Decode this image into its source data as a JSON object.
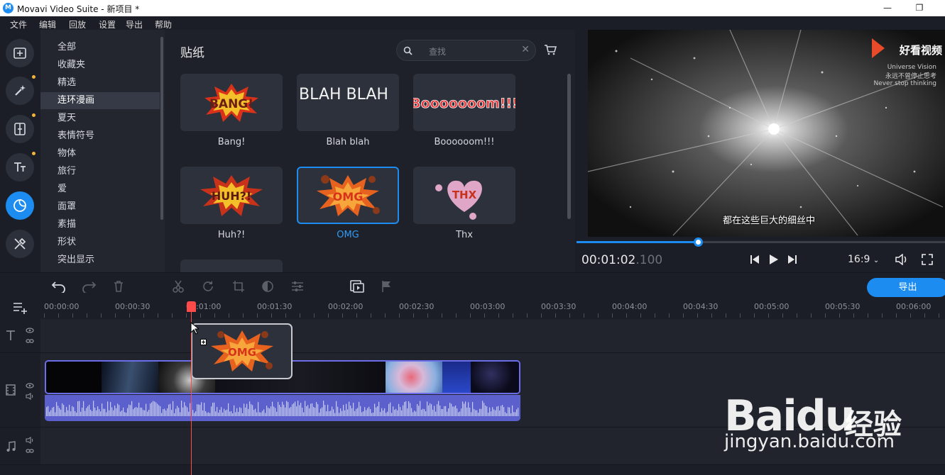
{
  "window": {
    "title": "Movavi Video Suite - 新项目 *",
    "minimize": "—",
    "restore": "❐"
  },
  "menu": [
    "文件",
    "编辑",
    "回放",
    "设置",
    "导出",
    "帮助"
  ],
  "categories": {
    "items": [
      "全部",
      "收藏夹",
      "精选",
      "连环漫画",
      "夏天",
      "表情符号",
      "物体",
      "旅行",
      "爱",
      "面罩",
      "素描",
      "形状",
      "突出显示"
    ],
    "selected": "连环漫画"
  },
  "stickers": {
    "title": "贴纸",
    "search_placeholder": "查找",
    "items": [
      {
        "label": "Bang!",
        "art": "BANG!"
      },
      {
        "label": "Blah blah",
        "art": "BLAH BLAH"
      },
      {
        "label": "Boooooom!!!",
        "art": "Booooooom!!!"
      },
      {
        "label": "Huh?!",
        "art": "HUH?!"
      },
      {
        "label": "OMG",
        "art": "OMG"
      },
      {
        "label": "Thx",
        "art": "THX"
      }
    ],
    "selected": "OMG"
  },
  "preview": {
    "brand": "好看视频",
    "brand_sub1": "Universe Vision",
    "brand_sub2": "永远不曾停止思考",
    "brand_sub3": "Never stop thinking",
    "subtitle": "都在这些巨大的细丝中",
    "timecode_main": "00:01:02",
    "timecode_ms": ".100",
    "progress_fraction": 0.33,
    "aspect": "16:9"
  },
  "toolbar": {
    "export_label": "导出"
  },
  "ruler": [
    "00:00:00",
    "00:00:30",
    "00:01:00",
    "00:01:30",
    "00:02:00",
    "00:02:30",
    "00:03:00",
    "00:03:30",
    "00:04:00",
    "00:04:30",
    "00:05:00",
    "00:05:30",
    "00:06:00"
  ],
  "timeline": {
    "dragged_sticker": "OMG"
  },
  "watermark": {
    "logo": "Baidu",
    "logo_cn": "经验",
    "url": "jingyan.baidu.com"
  },
  "colors": {
    "accent": "#1d8cf0",
    "playhead": "#ff4a4a",
    "clip_border": "#6b6ee8",
    "audio": "#5b60cc"
  }
}
